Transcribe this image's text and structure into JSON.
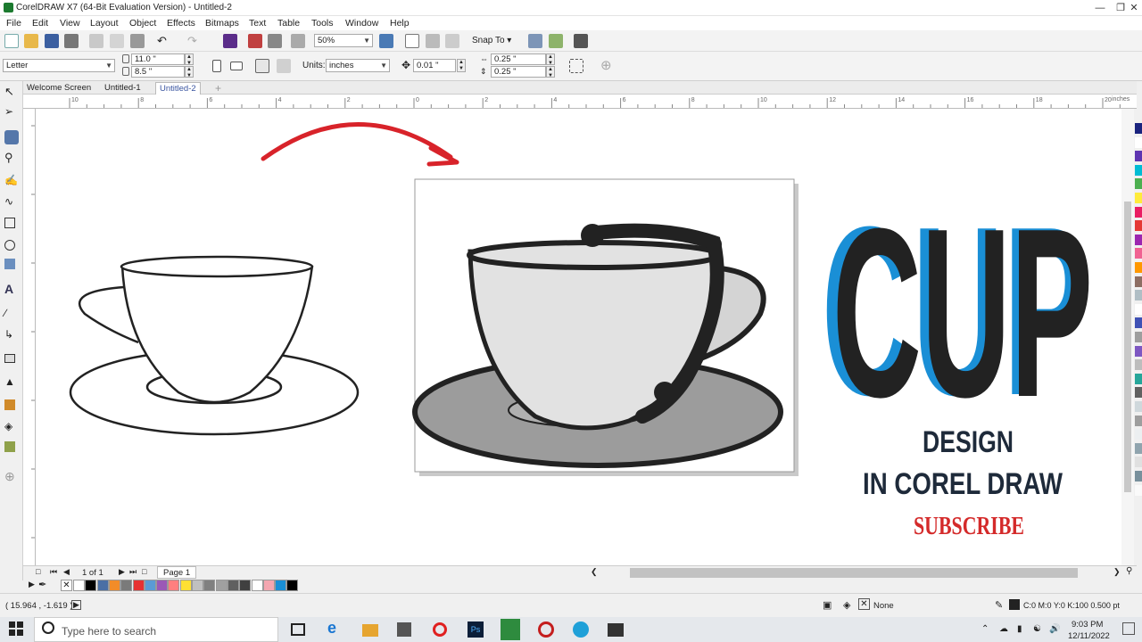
{
  "window": {
    "title": "CorelDRAW X7 (64-Bit Evaluation Version) - Untitled-2"
  },
  "menu": [
    "File",
    "Edit",
    "View",
    "Layout",
    "Object",
    "Effects",
    "Bitmaps",
    "Text",
    "Table",
    "Tools",
    "Window",
    "Help"
  ],
  "toolbar": {
    "zoom": "50%",
    "snap_to": "Snap To"
  },
  "property_bar": {
    "paper": "Letter",
    "width": "11.0 \"",
    "height": "8.5 \"",
    "units_label": "Units:",
    "units_value": "inches",
    "nudge": "0.01 \"",
    "dup_x": "0.25 \"",
    "dup_y": "0.25 \""
  },
  "doc_tabs": [
    "Welcome Screen",
    "Untitled-1",
    "Untitled-2"
  ],
  "ruler": {
    "h_ticks": [
      "10",
      "8",
      "6",
      "4",
      "2",
      "0",
      "2",
      "4",
      "6",
      "8",
      "10",
      "12",
      "14",
      "16",
      "18",
      "20"
    ],
    "unit": "inches"
  },
  "artwork": {
    "title": "CUP",
    "line1": "DESIGN",
    "line2": "IN COREL DRAW",
    "cta": "SUBSCRIBE"
  },
  "page_nav": {
    "counter": "1 of 1",
    "page_tab": "Page 1"
  },
  "status": {
    "coords": "( 15.964 , -1.619 )",
    "fill": "None",
    "outline": "C:0 M:0 Y:0 K:100  0.500 pt"
  },
  "taskbar": {
    "search_placeholder": "Type here to search",
    "time": "9:03 PM",
    "date": "12/11/2022"
  },
  "colors": {
    "accent_blue": "#1a8fd6",
    "cup_dark": "#222222",
    "arrow_red": "#d8232a",
    "subscribe_red": "#d42a2a",
    "text_navy": "#1e2a3a"
  },
  "palette_h": [
    "#ffffff",
    "#000000",
    "#4a6fa5",
    "#f28c28",
    "#7a7a7a",
    "#e63232",
    "#5b9bd5",
    "#9b59b6",
    "#ff7f7f",
    "#ffe033",
    "#c0c0c0",
    "#808080",
    "#a0a0a0",
    "#606060",
    "#404040",
    "#ffffff",
    "#f4a6b0",
    "#1a8fd6",
    "#000000"
  ],
  "palette_v": [
    "#1a237e",
    "#ffffff",
    "#5e35b1",
    "#00bcd4",
    "#4caf50",
    "#ffeb3b",
    "#e91e63",
    "#e53935",
    "#9c27b0",
    "#f06292",
    "#ff9800",
    "#8d6e63",
    "#b0bec5",
    "#ffffff",
    "#3f51b5",
    "#9e9e9e",
    "#7e57c2",
    "#bdbdbd",
    "#26a69a",
    "#616161",
    "#cfd8dc",
    "#9e9e9e",
    "#eceff1",
    "#90a4ae",
    "#e0e0e0",
    "#78909c",
    "#fafafa"
  ]
}
